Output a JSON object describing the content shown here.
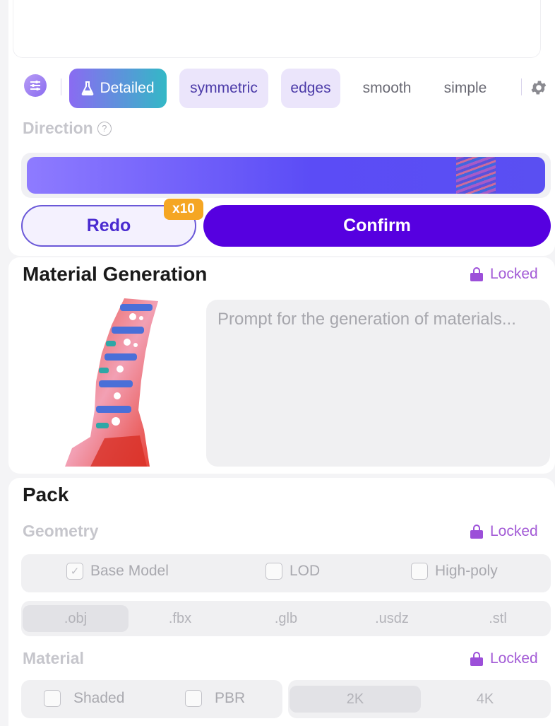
{
  "toolbar": {
    "chips": {
      "detailed": "Detailed",
      "symmetric": "symmetric",
      "edges": "edges",
      "smooth": "smooth",
      "simple": "simple"
    },
    "icons": {
      "menu": "sliders-icon",
      "detailed": "flask-icon",
      "settings": "gear-icon"
    }
  },
  "direction": {
    "label": "Direction",
    "help": "?"
  },
  "actions": {
    "redo": "Redo",
    "redo_badge": "x10",
    "confirm": "Confirm"
  },
  "material_generation": {
    "title": "Material Generation",
    "locked": "Locked",
    "prompt_placeholder": "Prompt for the generation of materials..."
  },
  "pack": {
    "title": "Pack",
    "geometry": {
      "label": "Geometry",
      "locked": "Locked",
      "options": {
        "base_model": "Base Model",
        "lod": "LOD",
        "high_poly": "High-poly"
      },
      "formats": {
        "obj": ".obj",
        "fbx": ".fbx",
        "glb": ".glb",
        "usdz": ".usdz",
        "stl": ".stl"
      }
    },
    "material": {
      "label": "Material",
      "locked": "Locked",
      "options": {
        "shaded": "Shaded",
        "pbr": "PBR"
      },
      "resolutions": {
        "r2k": "2K",
        "r4k": "4K"
      }
    }
  },
  "colors": {
    "accent": "#5600e0",
    "locked": "#a35bd6",
    "badge": "#f5a623"
  }
}
